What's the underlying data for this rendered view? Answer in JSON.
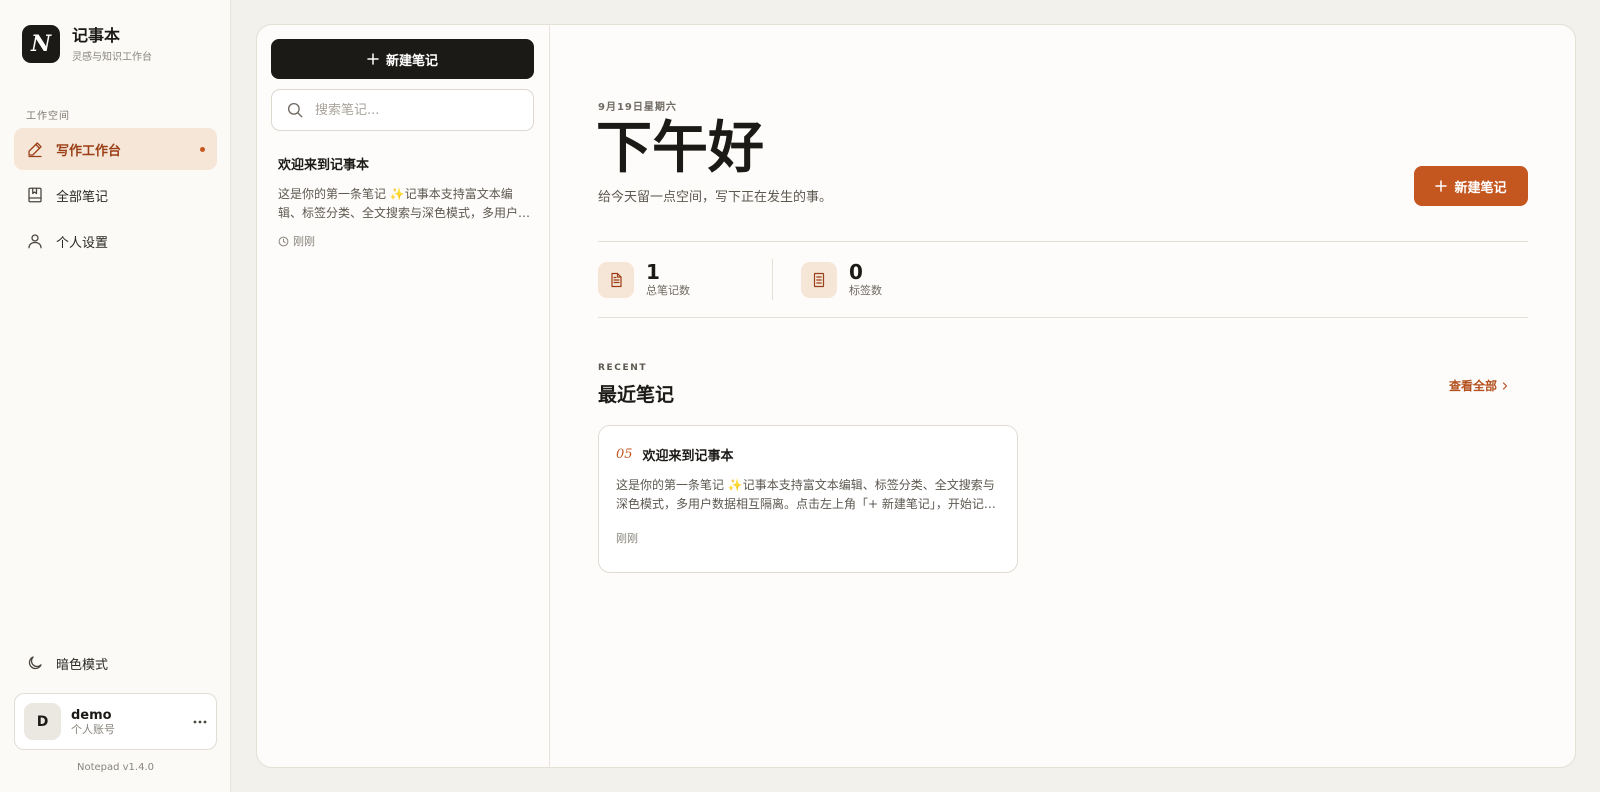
{
  "sidebar": {
    "logo_letter": "N",
    "app_title": "记事本",
    "app_subtitle": "灵感与知识工作台",
    "section_label": "工作空间",
    "items": [
      {
        "label": "写作工作台",
        "icon": "pen-icon",
        "active": true
      },
      {
        "label": "全部笔记",
        "icon": "book-icon",
        "active": false
      },
      {
        "label": "个人设置",
        "icon": "user-icon",
        "active": false
      }
    ],
    "dark_mode_label": "暗色模式",
    "user": {
      "initial": "D",
      "name": "demo",
      "role": "个人账号"
    },
    "version": "Notepad v1.4.0"
  },
  "notes_list": {
    "new_note_label": "新建笔记",
    "search_placeholder": "搜索笔记...",
    "items": [
      {
        "title": "欢迎来到记事本",
        "excerpt": "这是你的第一条笔记 ✨记事本支持富文本编辑、标签分类、全文搜索与深色模式，多用户数据相互隔离。",
        "time": "刚刚"
      }
    ]
  },
  "dashboard": {
    "date": "9月19日星期六",
    "greeting": "下午好",
    "subtitle": "给今天留一点空间，写下正在发生的事。",
    "new_note_label": "新建笔记",
    "stats": [
      {
        "value": "1",
        "label": "总笔记数",
        "icon": "document-icon"
      },
      {
        "value": "0",
        "label": "标签数",
        "icon": "list-icon"
      }
    ],
    "recent": {
      "eyebrow": "RECENT",
      "title": "最近笔记",
      "view_all": "查看全部",
      "cards": [
        {
          "number": "05",
          "title": "欢迎来到记事本",
          "excerpt": "这是你的第一条笔记 ✨记事本支持富文本编辑、标签分类、全文搜索与深色模式，多用户数据相互隔离。点击左上角「+ 新建笔记」，开始记录吧。",
          "time": "刚刚"
        }
      ]
    }
  },
  "colors": {
    "accent": "#c4561f",
    "accent_soft": "#f6e6d8",
    "dark": "#1c1a17",
    "background": "#f3f1ec"
  }
}
